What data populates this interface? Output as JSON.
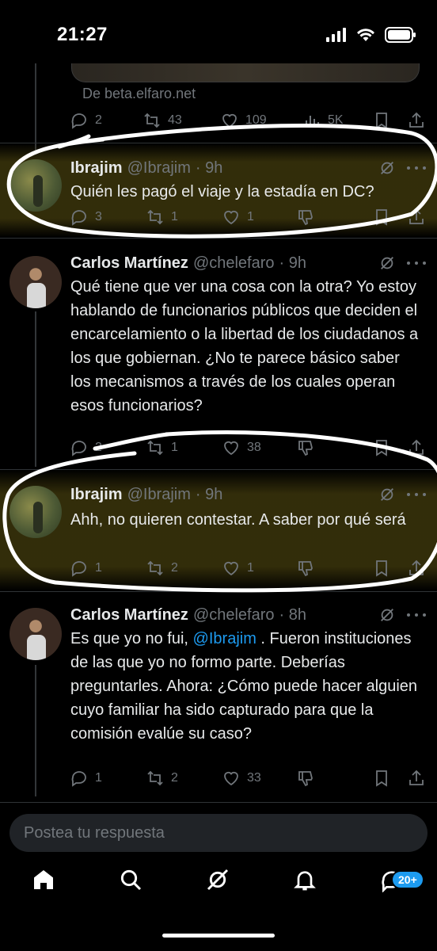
{
  "status_bar": {
    "time": "21:27"
  },
  "link_preview": {
    "source": "De beta.elfaro.net"
  },
  "top_actions": {
    "replies": "2",
    "reposts": "43",
    "likes": "109",
    "views": "5K"
  },
  "tweets": [
    {
      "name": "Ibrajim",
      "handle": "@Ibrajim",
      "time": "· 9h",
      "text": "Quién les pagó el viaje y la estadía en DC?",
      "replies": "3",
      "reposts": "1",
      "likes": "1"
    },
    {
      "name": "Carlos Martínez",
      "handle": "@chelefaro",
      "time": "· 9h",
      "text": "Qué tiene que ver una cosa con la otra? Yo estoy hablando de funcionarios públicos que deciden el encarcelamiento o la libertad de los ciudadanos a los que gobiernan. ¿No te parece básico saber los mecanismos a través de los cuales operan esos funcionarios?",
      "replies": "2",
      "reposts": "1",
      "likes": "38"
    },
    {
      "name": "Ibrajim",
      "handle": "@Ibrajim",
      "time": "· 9h",
      "text": "Ahh, no quieren contestar. A saber por qué será",
      "replies": "1",
      "reposts": "2",
      "likes": "1"
    },
    {
      "name": "Carlos Martínez",
      "handle": "@chelefaro",
      "time": "· 8h",
      "text_before": "Es que yo no fui, ",
      "mention": "@Ibrajim",
      "text_after": " . Fueron instituciones de las que yo no formo parte. Deberías preguntarles.  Ahora: ¿Cómo puede hacer alguien cuyo familiar ha sido capturado para que la comisión evalúe su caso?",
      "replies": "1",
      "reposts": "2",
      "likes": "33"
    }
  ],
  "reply_box": {
    "placeholder": "Postea tu respuesta"
  },
  "tab_bar": {
    "messages_badge": "20+"
  },
  "colors": {
    "accent": "#1d9bf0",
    "highlight": "#5c5212",
    "annotation": "#ffffff"
  }
}
